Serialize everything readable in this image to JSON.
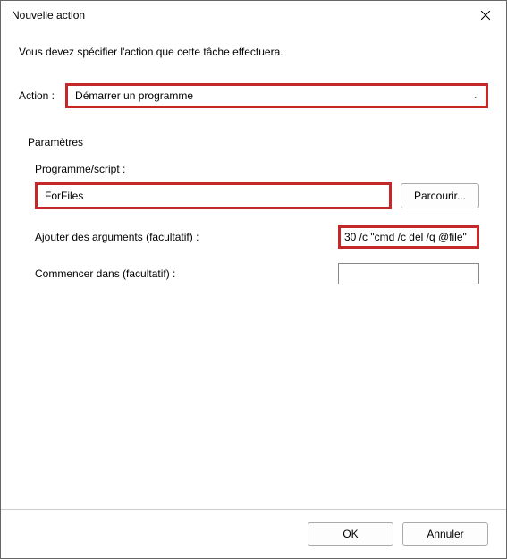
{
  "titlebar": {
    "title": "Nouvelle action"
  },
  "instruction": "Vous devez spécifier l'action que cette tâche effectuera.",
  "action": {
    "label": "Action :",
    "selected": "Démarrer un programme"
  },
  "parameters": {
    "legend": "Paramètres",
    "program": {
      "label": "Programme/script :",
      "value": "ForFiles",
      "browse": "Parcourir..."
    },
    "arguments": {
      "label": "Ajouter des arguments (facultatif) :",
      "value": "30 /c \"cmd /c del /q @file\""
    },
    "startin": {
      "label": "Commencer dans (facultatif) :",
      "value": ""
    }
  },
  "footer": {
    "ok": "OK",
    "cancel": "Annuler"
  },
  "highlight_color": "#c42828"
}
